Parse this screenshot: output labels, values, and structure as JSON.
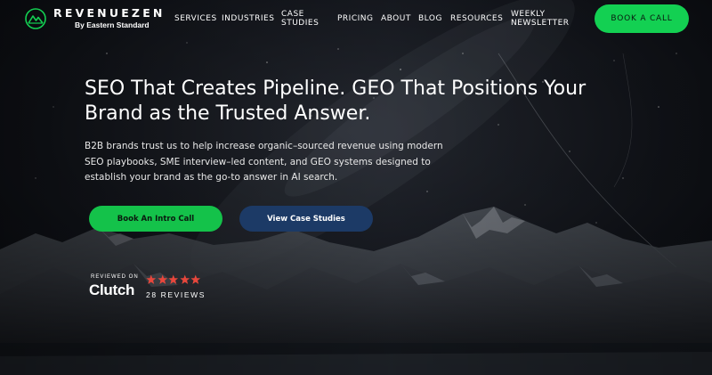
{
  "brand": {
    "name": "REVENUEZEN",
    "subtitle": "By Eastern Standard",
    "logo_icon": "mountain-peaks-icon"
  },
  "nav": {
    "items": [
      {
        "label": "SERVICES"
      },
      {
        "label": "INDUSTRIES"
      },
      {
        "label": "CASE\nSTUDIES"
      },
      {
        "label": "PRICING"
      },
      {
        "label": "ABOUT"
      },
      {
        "label": "BLOG"
      },
      {
        "label": "RESOURCES"
      },
      {
        "label": "WEEKLY\nNEWSLETTER"
      }
    ],
    "cta_label": "BOOK A CALL"
  },
  "hero": {
    "title": "SEO That Creates Pipeline. GEO That Positions Your Brand as the Trusted Answer.",
    "subtitle": "B2B brands trust us to help increase organic–sourced revenue using modern SEO playbooks, SME interview–led content, and GEO systems designed to establish your brand as the go-to answer in AI search.",
    "primary_button": "Book An Intro Call",
    "secondary_button": "View Case Studies"
  },
  "clutch": {
    "reviewed_on": "REVIEWED ON",
    "logo_text": "Clutch",
    "rating_stars": 5,
    "reviews_count": "28 REVIEWS"
  },
  "colors": {
    "accent_green": "#13d052",
    "secondary_button": "#1c3a66",
    "star_red": "#e8473c",
    "clutch_dot": "#ef3e36",
    "background": "#0b0e14"
  }
}
